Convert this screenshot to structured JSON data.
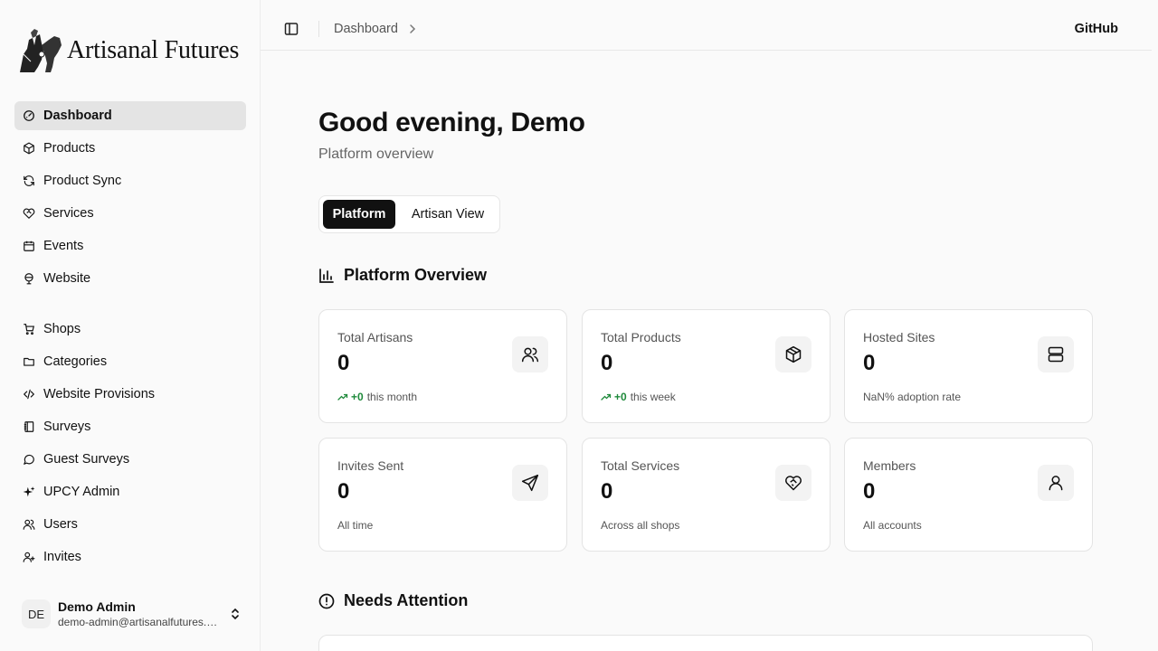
{
  "app": {
    "name": "Artisanal Futures"
  },
  "sidebar": {
    "nav_primary": [
      {
        "label": "Dashboard",
        "icon": "gauge-icon",
        "active": true
      },
      {
        "label": "Products",
        "icon": "box-icon"
      },
      {
        "label": "Product Sync",
        "icon": "refresh-icon"
      },
      {
        "label": "Services",
        "icon": "heart-handshake-icon"
      },
      {
        "label": "Events",
        "icon": "calendar-icon"
      },
      {
        "label": "Website",
        "icon": "globe-icon"
      }
    ],
    "nav_secondary": [
      {
        "label": "Shops",
        "icon": "store-icon"
      },
      {
        "label": "Categories",
        "icon": "folder-icon"
      },
      {
        "label": "Website Provisions",
        "icon": "code-icon"
      },
      {
        "label": "Surveys",
        "icon": "notebook-icon"
      },
      {
        "label": "Guest Surveys",
        "icon": "message-circle-icon"
      },
      {
        "label": "UPCY Admin",
        "icon": "sparkles-icon"
      },
      {
        "label": "Users",
        "icon": "users-icon"
      },
      {
        "label": "Invites",
        "icon": "user-plus-icon"
      }
    ],
    "user": {
      "initials": "DE",
      "name": "Demo Admin",
      "email": "demo-admin@artisanalfutures.org"
    }
  },
  "topbar": {
    "breadcrumb": "Dashboard",
    "github_label": "GitHub"
  },
  "main": {
    "greeting": "Good evening, Demo",
    "subtitle": "Platform overview",
    "view_toggle": {
      "active": "Platform",
      "inactive": "Artisan View"
    },
    "overview_title": "Platform Overview",
    "attention_title": "Needs Attention"
  },
  "stats": [
    {
      "label": "Total Artisans",
      "value": "0",
      "trend": "+0",
      "foot": "this month",
      "icon": "users-icon"
    },
    {
      "label": "Total Products",
      "value": "0",
      "trend": "+0",
      "foot": "this week",
      "icon": "box-icon"
    },
    {
      "label": "Hosted Sites",
      "value": "0",
      "trend": "",
      "foot": "NaN% adoption rate",
      "icon": "server-icon"
    },
    {
      "label": "Invites Sent",
      "value": "0",
      "trend": "",
      "foot": "All time",
      "icon": "send-icon"
    },
    {
      "label": "Total Services",
      "value": "0",
      "trend": "",
      "foot": "Across all shops",
      "icon": "heart-handshake-icon"
    },
    {
      "label": "Members",
      "value": "0",
      "trend": "",
      "foot": "All accounts",
      "icon": "user-icon"
    }
  ],
  "colors": {
    "accent": "#111111",
    "trend_up": "#1f8a3b",
    "active_nav_bg": "#e4e4e4"
  }
}
